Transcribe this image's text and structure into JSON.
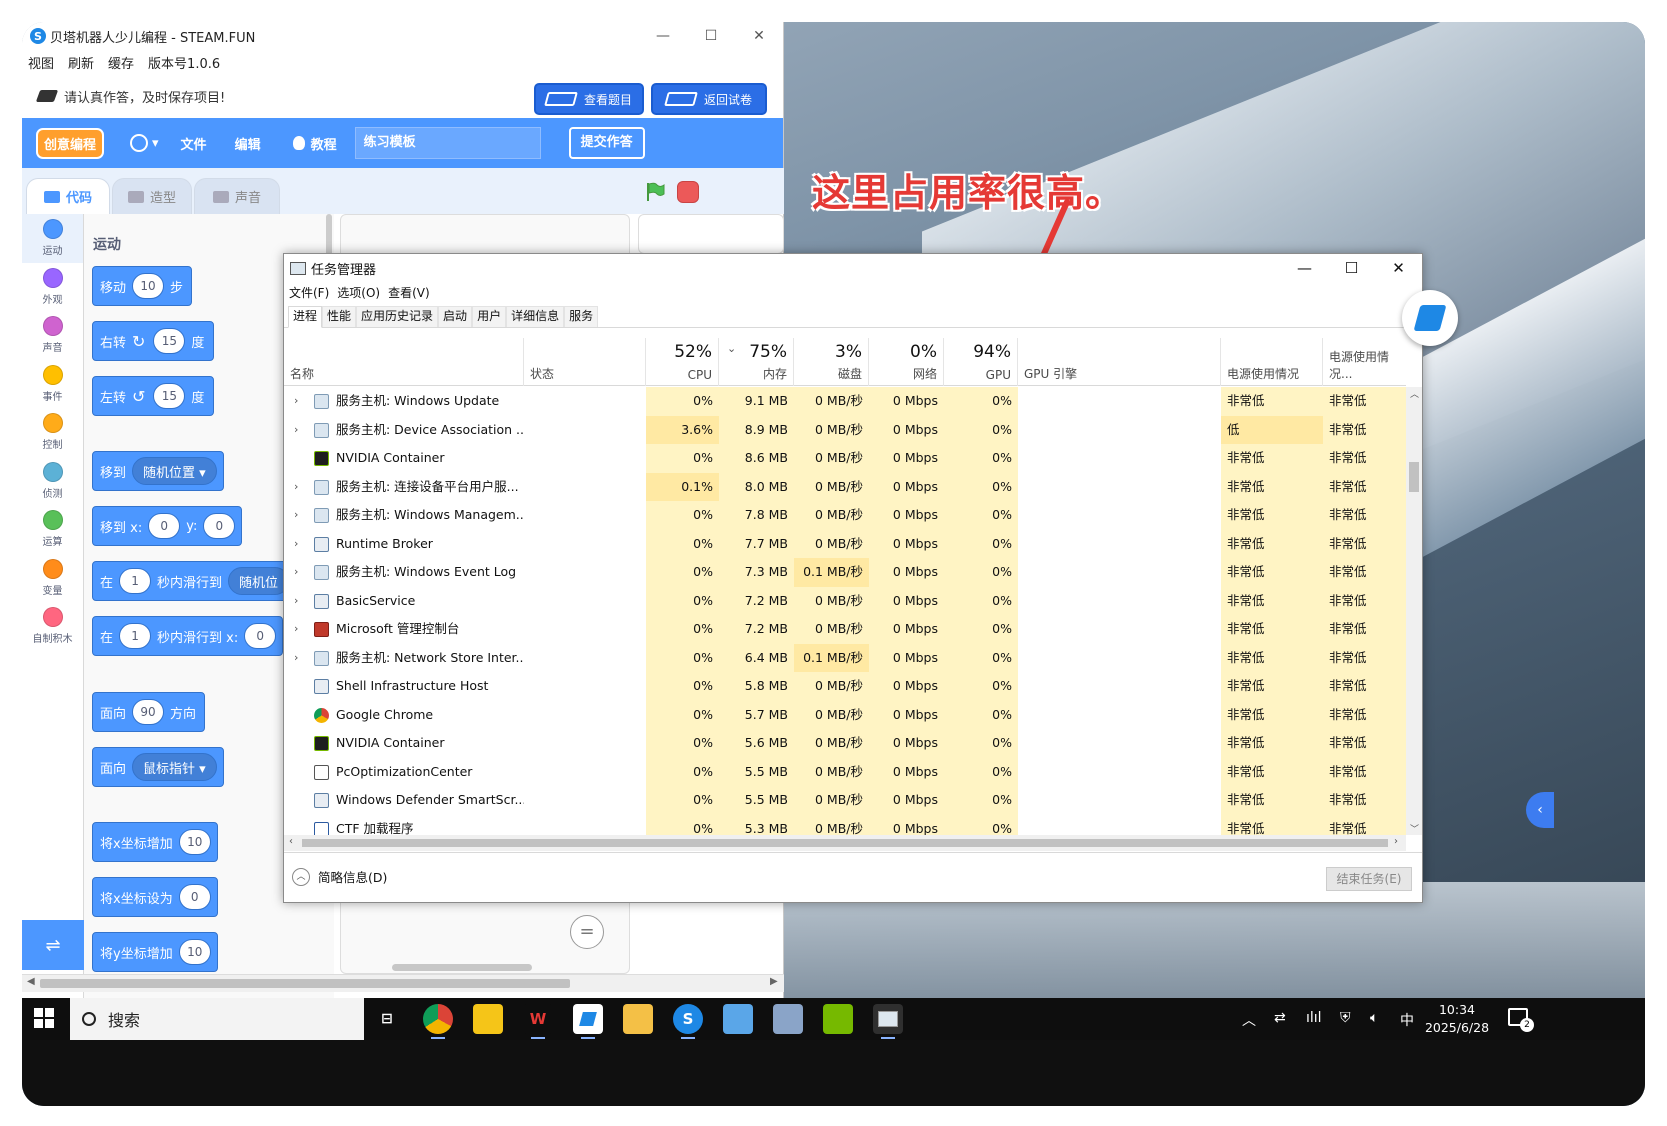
{
  "steam": {
    "title": "贝塔机器人少儿编程 - STEAM.FUN",
    "menu": [
      "视图",
      "刷新",
      "缓存",
      "版本号1.0.6"
    ],
    "notice": "请认真作答，及时保存项目!",
    "btn_view_task": "查看题目",
    "btn_return_exam": "返回试卷",
    "logo": "创意编程",
    "tb_file": "文件",
    "tb_edit": "编辑",
    "tb_tutorial": "教程",
    "project_name": "练习模板",
    "submit": "提交作答",
    "tabs": {
      "code": "代码",
      "costume": "造型",
      "sound": "声音"
    },
    "categories": [
      {
        "label": "运动",
        "color": "#4c97ff"
      },
      {
        "label": "外观",
        "color": "#9966ff"
      },
      {
        "label": "声音",
        "color": "#cf63cf"
      },
      {
        "label": "事件",
        "color": "#ffbf00"
      },
      {
        "label": "控制",
        "color": "#ffab19"
      },
      {
        "label": "侦测",
        "color": "#5cb1d6"
      },
      {
        "label": "运算",
        "color": "#59c059"
      },
      {
        "label": "变量",
        "color": "#ff8c1a"
      },
      {
        "label": "自制积木",
        "color": "#ff6680"
      }
    ],
    "palette_title": "运动",
    "blocks": {
      "move": {
        "a": "移动",
        "v": "10",
        "b": "步"
      },
      "turn_right": {
        "a": "右转",
        "icon": "↻",
        "v": "15",
        "b": "度"
      },
      "turn_left": {
        "a": "左转",
        "icon": "↺",
        "v": "15",
        "b": "度"
      },
      "goto_random": {
        "a": "移到",
        "dd": "随机位置 ▾"
      },
      "goto_xy": {
        "a": "移到 x:",
        "x": "0",
        "ylbl": "y:",
        "y": "0"
      },
      "glide_random": {
        "a": "在",
        "v": "1",
        "b": "秒内滑行到",
        "dd": "随机位"
      },
      "glide_xy": {
        "a": "在",
        "v": "1",
        "b": "秒内滑行到 x:",
        "x": "0"
      },
      "point_dir": {
        "a": "面向",
        "v": "90",
        "b": "方向"
      },
      "point_towards": {
        "a": "面向",
        "dd": "鼠标指针 ▾"
      },
      "change_x": {
        "a": "将x坐标增加",
        "v": "10"
      },
      "set_x": {
        "a": "将x坐标设为",
        "v": "0"
      },
      "change_y": {
        "a": "将y坐标增加",
        "v": "10"
      }
    },
    "zoom_eq": "="
  },
  "annotation": "这里占用率很高。",
  "taskmgr": {
    "title": "任务管理器",
    "menu": [
      "文件(F)",
      "选项(O)",
      "查看(V)"
    ],
    "tabs": [
      "进程",
      "性能",
      "应用历史记录",
      "启动",
      "用户",
      "详细信息",
      "服务"
    ],
    "columns": {
      "name": "名称",
      "status": "状态",
      "cpu_pct": "52%",
      "cpu": "CPU",
      "mem_pct": "75%",
      "mem": "内存",
      "disk_pct": "3%",
      "disk": "磁盘",
      "net_pct": "0%",
      "net": "网络",
      "gpu_pct": "94%",
      "gpu": "GPU",
      "gpu_engine": "GPU 引擎",
      "power": "电源使用情况",
      "power_trend": "电源使用情况..."
    },
    "rows": [
      {
        "exp": "›",
        "icon": "gear",
        "name": "服务主机: Windows Update",
        "cpu": "0%",
        "mem": "9.1 MB",
        "disk": "0 MB/秒",
        "net": "0 Mbps",
        "gpu": "0%",
        "p1": "非常低",
        "p2": "非常低"
      },
      {
        "exp": "›",
        "icon": "gear",
        "name": "服务主机: Device Association ...",
        "cpu": "3.6%",
        "mem": "8.9 MB",
        "disk": "0 MB/秒",
        "net": "0 Mbps",
        "gpu": "0%",
        "p1": "低",
        "p2": "非常低"
      },
      {
        "exp": "",
        "icon": "nv",
        "name": "NVIDIA Container",
        "cpu": "0%",
        "mem": "8.6 MB",
        "disk": "0 MB/秒",
        "net": "0 Mbps",
        "gpu": "0%",
        "p1": "非常低",
        "p2": "非常低"
      },
      {
        "exp": "›",
        "icon": "gear",
        "name": "服务主机: 连接设备平台用户服...",
        "cpu": "0.1%",
        "mem": "8.0 MB",
        "disk": "0 MB/秒",
        "net": "0 Mbps",
        "gpu": "0%",
        "p1": "非常低",
        "p2": "非常低"
      },
      {
        "exp": "›",
        "icon": "gear",
        "name": "服务主机: Windows Managem...",
        "cpu": "0%",
        "mem": "7.8 MB",
        "disk": "0 MB/秒",
        "net": "0 Mbps",
        "gpu": "0%",
        "p1": "非常低",
        "p2": "非常低"
      },
      {
        "exp": "›",
        "icon": "win",
        "name": "Runtime Broker",
        "cpu": "0%",
        "mem": "7.7 MB",
        "disk": "0 MB/秒",
        "net": "0 Mbps",
        "gpu": "0%",
        "p1": "非常低",
        "p2": "非常低"
      },
      {
        "exp": "›",
        "icon": "gear",
        "name": "服务主机: Windows Event Log",
        "cpu": "0%",
        "mem": "7.3 MB",
        "disk": "0.1 MB/秒",
        "net": "0 Mbps",
        "gpu": "0%",
        "p1": "非常低",
        "p2": "非常低"
      },
      {
        "exp": "›",
        "icon": "win",
        "name": "BasicService",
        "cpu": "0%",
        "mem": "7.2 MB",
        "disk": "0 MB/秒",
        "net": "0 Mbps",
        "gpu": "0%",
        "p1": "非常低",
        "p2": "非常低"
      },
      {
        "exp": "›",
        "icon": "mmc",
        "name": "Microsoft 管理控制台",
        "cpu": "0%",
        "mem": "7.2 MB",
        "disk": "0 MB/秒",
        "net": "0 Mbps",
        "gpu": "0%",
        "p1": "非常低",
        "p2": "非常低"
      },
      {
        "exp": "›",
        "icon": "gear",
        "name": "服务主机: Network Store Inter...",
        "cpu": "0%",
        "mem": "6.4 MB",
        "disk": "0.1 MB/秒",
        "net": "0 Mbps",
        "gpu": "0%",
        "p1": "非常低",
        "p2": "非常低"
      },
      {
        "exp": "",
        "icon": "win",
        "name": "Shell Infrastructure Host",
        "cpu": "0%",
        "mem": "5.8 MB",
        "disk": "0 MB/秒",
        "net": "0 Mbps",
        "gpu": "0%",
        "p1": "非常低",
        "p2": "非常低"
      },
      {
        "exp": "",
        "icon": "chrome",
        "name": "Google Chrome",
        "cpu": "0%",
        "mem": "5.7 MB",
        "disk": "0 MB/秒",
        "net": "0 Mbps",
        "gpu": "0%",
        "p1": "非常低",
        "p2": "非常低"
      },
      {
        "exp": "",
        "icon": "nv",
        "name": "NVIDIA Container",
        "cpu": "0%",
        "mem": "5.6 MB",
        "disk": "0 MB/秒",
        "net": "0 Mbps",
        "gpu": "0%",
        "p1": "非常低",
        "p2": "非常低"
      },
      {
        "exp": "",
        "icon": "pc",
        "name": "PcOptimizationCenter",
        "cpu": "0%",
        "mem": "5.5 MB",
        "disk": "0 MB/秒",
        "net": "0 Mbps",
        "gpu": "0%",
        "p1": "非常低",
        "p2": "非常低"
      },
      {
        "exp": "",
        "icon": "win",
        "name": "Windows Defender SmartScr...",
        "cpu": "0%",
        "mem": "5.5 MB",
        "disk": "0 MB/秒",
        "net": "0 Mbps",
        "gpu": "0%",
        "p1": "非常低",
        "p2": "非常低"
      },
      {
        "exp": "",
        "icon": "ctf",
        "name": "CTF 加载程序",
        "cpu": "0%",
        "mem": "5.3 MB",
        "disk": "0 MB/秒",
        "net": "0 Mbps",
        "gpu": "0%",
        "p1": "非常低",
        "p2": "非常低"
      }
    ],
    "fewer_details": "简略信息(D)",
    "end_task": "结束任务(E)"
  },
  "taskbar": {
    "search": "搜索",
    "ime": "中",
    "time": "10:34",
    "date": "2025/6/28",
    "notif_count": "2"
  }
}
